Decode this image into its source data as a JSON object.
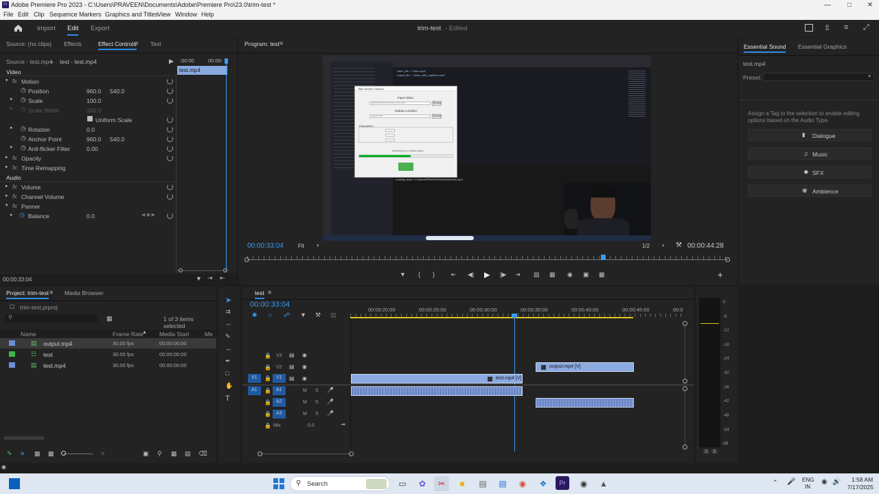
{
  "window": {
    "title": "Adobe Premiere Pro 2023 - C:\\Users\\PRAVEEN\\Documents\\Adobe\\Premiere Pro\\23.0\\trim-test *",
    "app_icon": "Pr"
  },
  "menu": [
    "File",
    "Edit",
    "Clip",
    "Sequence",
    "Markers",
    "Graphics and Titles",
    "View",
    "Window",
    "Help"
  ],
  "header": {
    "tabs": [
      "Import",
      "Edit",
      "Export"
    ],
    "active_tab": "Edit",
    "project_name": "trim-test",
    "status": "- Edited"
  },
  "effect_controls": {
    "tabs": [
      "Source: (no clips)",
      "Effects",
      "Effect Controls",
      "Text"
    ],
    "master": "Source - test.mp4",
    "clip": "test - test.mp4",
    "timecode_start": ":00:00",
    "timecode_end": "00:00:",
    "clip_label": "test.mp4",
    "section_video": "Video",
    "section_audio": "Audio",
    "motion": "Motion",
    "position_label": "Position",
    "position_x": "960.0",
    "position_y": "540.0",
    "scale_label": "Scale",
    "scale_val": "100.0",
    "scale_width_label": "Scale Width",
    "scale_width_val": "100.0",
    "uniform_scale": "Uniform Scale",
    "rotation_label": "Rotation",
    "rotation_val": "0.0",
    "anchor_label": "Anchor Point",
    "anchor_x": "960.0",
    "anchor_y": "540.0",
    "antiflicker_label": "Anti-flicker Filter",
    "antiflicker_val": "0.00",
    "opacity": "Opacity",
    "time_remap": "Time Remapping",
    "volume": "Volume",
    "channel_volume": "Channel Volume",
    "panner": "Panner",
    "balance_label": "Balance",
    "balance_val": "0.0",
    "current_time": "00:00:33:04"
  },
  "program_monitor": {
    "title": "Program: test",
    "timecode": "00:00:33:04",
    "fit": "Fit",
    "resolution": "1/2",
    "duration": "00:00:44:28",
    "progress": 0.74
  },
  "essential_sound": {
    "tabs": [
      "Essential Sound",
      "Essential Graphics"
    ],
    "clip": "test.mp4",
    "preset_label": "Preset:",
    "hint": "Assign a Tag to the selection to enable editing options based on the Audio Type.",
    "types": [
      "Dialogue",
      "Music",
      "SFX",
      "Ambience"
    ]
  },
  "project": {
    "tabs": [
      "Project: trim-test",
      "Media Browser"
    ],
    "file": "trim-test.prproj",
    "selection_info": "1 of 3 items selected",
    "columns": [
      "Name",
      "Frame Rate",
      "Media Start",
      "Me"
    ],
    "items": [
      {
        "name": "output.mp4",
        "rate": "30.00 fps",
        "start": "00:00:00:00",
        "color": "#6b8fd6",
        "selected": true
      },
      {
        "name": "test",
        "rate": "30.00 fps",
        "start": "00:00:00:00",
        "color": "#3fb24a",
        "selected": false
      },
      {
        "name": "test.mp4",
        "rate": "30.00 fps",
        "start": "00:00:00:00",
        "color": "#6b8fd6",
        "selected": false
      }
    ]
  },
  "timeline": {
    "title": "test",
    "timecode": "00:00:33:04",
    "ruler": [
      "00:00:20:00",
      "00:00:25:00",
      "00:00:30:00",
      "00:00:35:00",
      "00:00:40:00",
      "00:00:45:00",
      "00:0"
    ],
    "tracks_video": [
      "V3",
      "V2",
      "V1"
    ],
    "tracks_audio": [
      "A1",
      "A2",
      "A3"
    ],
    "source_v": "V1",
    "source_a": "A1",
    "mix_label": "Mix",
    "mix_val": "0.0",
    "clip_v1": "test.mp4 [V]",
    "clip_v2": "output.mp4 [V]",
    "mute": "M",
    "solo": "S"
  },
  "audio_meter": {
    "ticks": [
      "0",
      "-6",
      "-12",
      "-18",
      "-24",
      "-30",
      "-36",
      "-42",
      "-48",
      "-54",
      "dB"
    ],
    "solo": [
      "S",
      "S"
    ]
  },
  "taskbar": {
    "search": "Search",
    "lang1": "ENG",
    "lang2": "IN",
    "time": "1:58 AM",
    "date": "7/17/2025"
  },
  "video_frame": {
    "dialog_title": "Take Screen Trimmer",
    "input_label": "Input Video:",
    "input_val": "data/d/lectures/tutorial_new.mp4",
    "browse": "Browse",
    "output_label": "Output Location:",
    "output_val": "output.mp4",
    "params": "Parameters",
    "status": "Detecting non-silent parts...",
    "progress": 0.55,
    "code1": "video_file = \"video.mp4\"",
    "code2": "output_file = \"video_with_captions.mp4\"",
    "console": "Loading video: C:/Users/PRAVEEN/Videos/lecture.mp4"
  },
  "colors": {
    "accent": "#2d8ceb",
    "clip": "#8aaae0",
    "playhead": "#4a90e2"
  }
}
